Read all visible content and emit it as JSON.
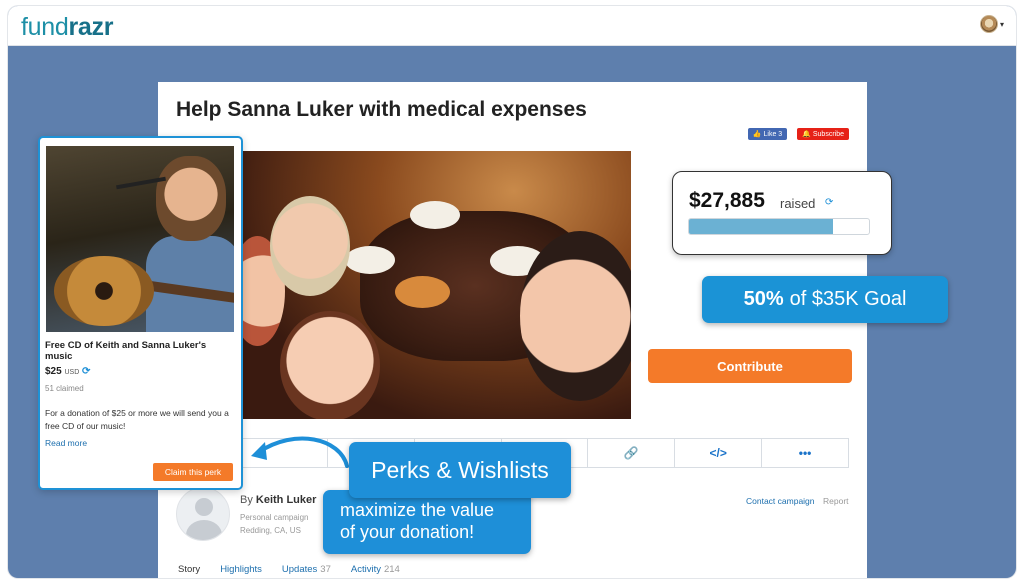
{
  "brand": {
    "logo_part1": "fund",
    "logo_part2": "razr"
  },
  "header": {
    "avatar_caret": "▾"
  },
  "campaign": {
    "title": "Help Sanna Luker with medical expenses",
    "social": {
      "like_label": "Like 3",
      "subscribe_label": "Subscribe"
    },
    "contribute_label": "Contribute",
    "share_icons": [
      "facebook-icon",
      "twitter-icon",
      "email-icon",
      "embed-card-icon",
      "link-icon",
      "code-icon",
      "more-icon"
    ],
    "share_glyphs": [
      "",
      "",
      "",
      "",
      "🔗",
      "</>",
      "•••"
    ],
    "owner": {
      "by_prefix": "By",
      "name": "Keith Luker",
      "type": "Personal campaign",
      "location": "Redding, CA, US",
      "contact_label": "Contact campaign",
      "report_label": "Report"
    },
    "tabs": [
      {
        "label": "Story",
        "count": ""
      },
      {
        "label": "Highlights",
        "count": ""
      },
      {
        "label": "Updates",
        "count": "37"
      },
      {
        "label": "Activity",
        "count": "214"
      }
    ]
  },
  "perk": {
    "title": "Free CD of Keith and Sanna Luker's music",
    "price": "$25",
    "currency": "USD",
    "claimed": "51 claimed",
    "description": "For a donation of $25 or more we will send you a free CD of our music!",
    "read_more": "Read more",
    "claim_label": "Claim this perk"
  },
  "raised": {
    "amount": "$27,885",
    "label": "raised",
    "progress_fraction": 0.8
  },
  "goal": {
    "percent": "50%",
    "text": "of $35K Goal"
  },
  "callouts": {
    "perks": "Perks & Wishlists",
    "value_line1": "maximize the value",
    "value_line2": "of your donation!"
  },
  "colors": {
    "brand_teal": "#1d8fa6",
    "accent_orange": "#f47a29",
    "callout_blue": "#1e8fd8",
    "background_blue": "#5e7fad"
  }
}
